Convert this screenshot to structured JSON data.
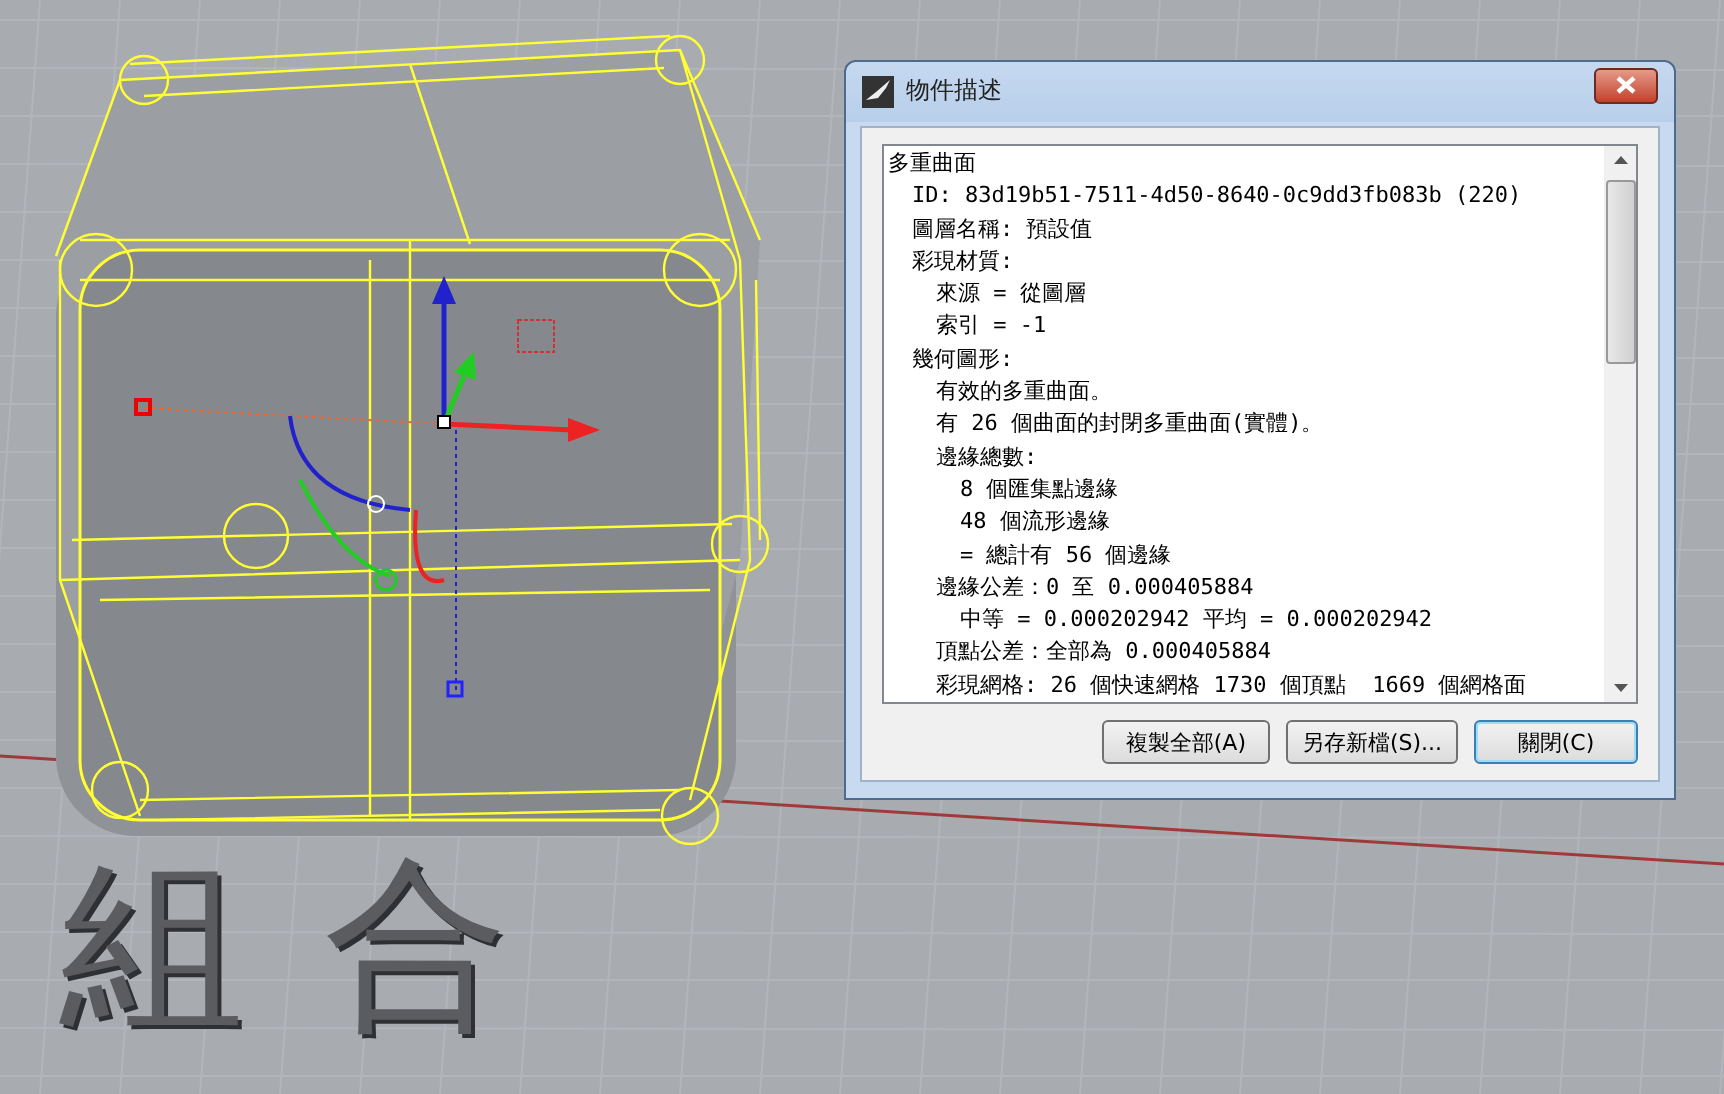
{
  "scene_label": "組合",
  "dialog": {
    "title": "物件描述",
    "lines": [
      {
        "text": "多重曲面",
        "children": [
          {
            "text": "ID: 83d19b51-7511-4d50-8640-0c9dd3fb083b (220)"
          },
          {
            "text": "圖層名稱: 預設值"
          },
          {
            "text": "彩現材質:",
            "children": [
              {
                "text": "來源 = 從圖層"
              },
              {
                "text": "索引 = -1"
              }
            ]
          },
          {
            "text": "幾何圖形:",
            "children": [
              {
                "text": "有效的多重曲面。"
              },
              {
                "text": "有 26 個曲面的封閉多重曲面(實體)。"
              },
              {
                "text": "邊緣總數:",
                "children": [
                  {
                    "text": "8 個匯集點邊緣"
                  },
                  {
                    "text": "48 個流形邊緣"
                  },
                  {
                    "text": "= 總計有 56 個邊緣"
                  }
                ]
              },
              {
                "text": "邊緣公差：0 至 0.000405884",
                "children": [
                  {
                    "text": "中等 = 0.000202942 平均 = 0.000202942"
                  }
                ]
              },
              {
                "text": "頂點公差：全部為 0.000405884"
              },
              {
                "text": "彩現網格: 26 個快速網格 1730 個頂點  1669 個網格面"
              }
            ]
          }
        ]
      }
    ],
    "buttons": [
      {
        "label": "複製全部(A)",
        "default": false
      },
      {
        "label": "另存新檔(S)...",
        "default": false
      },
      {
        "label": "關閉(C)",
        "default": true
      }
    ]
  }
}
